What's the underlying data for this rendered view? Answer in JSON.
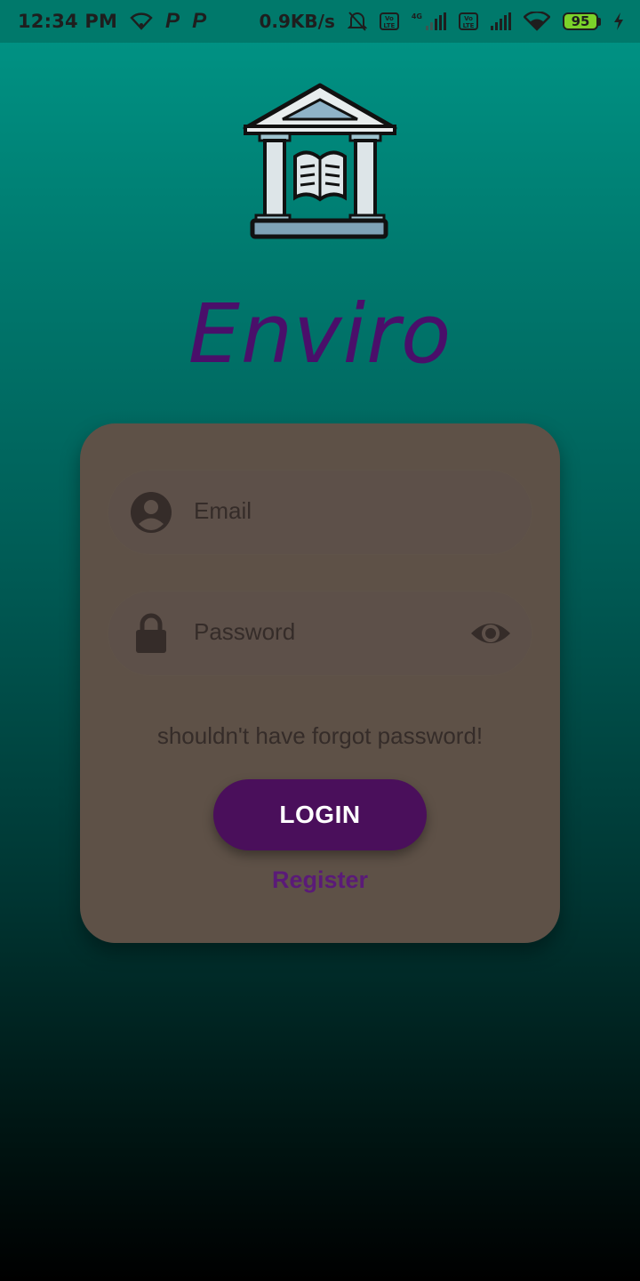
{
  "status_bar": {
    "time": "12:34 PM",
    "speed": "0.9KB/s",
    "volte_label": "Vo LTE",
    "network_label": "4G",
    "battery": "95"
  },
  "app": {
    "title": "Enviro",
    "logo_icon": "library-building-book-icon"
  },
  "login_form": {
    "email_placeholder": "Email",
    "password_placeholder": "Password",
    "forgot_text": "shouldn't have forgot password!",
    "login_label": "LOGIN",
    "register_label": "Register"
  },
  "colors": {
    "accent": "#4a0f5b",
    "card": "#5e5147",
    "title": "#4a0f6a"
  }
}
